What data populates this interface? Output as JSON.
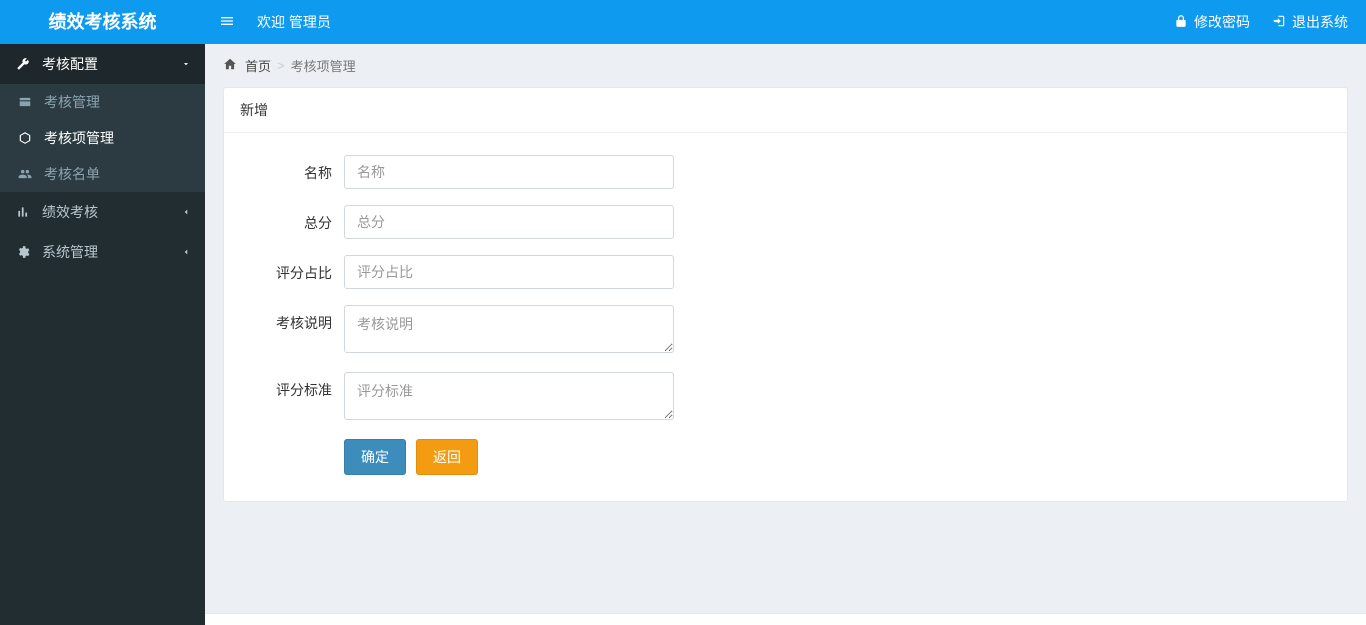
{
  "app": {
    "title": "绩效考核系统"
  },
  "header": {
    "welcome": "欢迎 管理员",
    "change_password": "修改密码",
    "logout": "退出系统"
  },
  "sidebar": {
    "items": [
      {
        "label": "考核配置",
        "expanded": true,
        "children": [
          {
            "label": "考核管理"
          },
          {
            "label": "考核项管理",
            "active": true
          },
          {
            "label": "考核名单"
          }
        ]
      },
      {
        "label": "绩效考核"
      },
      {
        "label": "系统管理"
      }
    ]
  },
  "breadcrumb": {
    "home": "首页",
    "current": "考核项管理"
  },
  "panel": {
    "title": "新增"
  },
  "form": {
    "name": {
      "label": "名称",
      "placeholder": "名称",
      "value": ""
    },
    "total_score": {
      "label": "总分",
      "placeholder": "总分",
      "value": ""
    },
    "score_ratio": {
      "label": "评分占比",
      "placeholder": "评分占比",
      "value": ""
    },
    "description": {
      "label": "考核说明",
      "placeholder": "考核说明",
      "value": ""
    },
    "criteria": {
      "label": "评分标准",
      "placeholder": "评分标准",
      "value": ""
    },
    "submit": "确定",
    "back": "返回"
  },
  "footer": {
    "version": ""
  }
}
